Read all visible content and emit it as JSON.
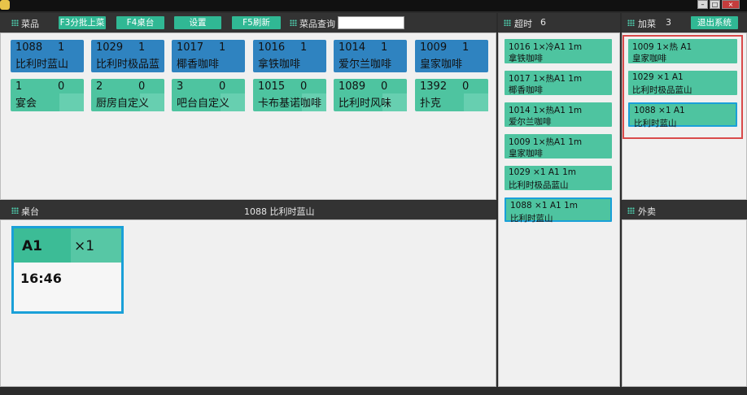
{
  "window": {
    "controls": [
      "–",
      "□",
      "×"
    ]
  },
  "toolbar": {
    "dishes_label": "菜品",
    "btn_batch": "F3分批上菜",
    "btn_table": "F4桌台",
    "btn_settings": "设置",
    "btn_refresh": "F5刷新",
    "search_label": "菜品查询",
    "search_value": ""
  },
  "dishes": [
    {
      "code": "1088",
      "count": "1",
      "name": "比利时蓝山",
      "color": "blue"
    },
    {
      "code": "1029",
      "count": "1",
      "name": "比利时极品蓝",
      "color": "blue"
    },
    {
      "code": "1017",
      "count": "1",
      "name": "椰香咖啡",
      "color": "blue"
    },
    {
      "code": "1016",
      "count": "1",
      "name": "拿铁咖啡",
      "color": "blue"
    },
    {
      "code": "1014",
      "count": "1",
      "name": "爱尔兰咖啡",
      "color": "blue"
    },
    {
      "code": "1009",
      "count": "1",
      "name": "皇家咖啡",
      "color": "blue"
    },
    {
      "code": "1",
      "count": "0",
      "name": "宴会",
      "color": "green"
    },
    {
      "code": "2",
      "count": "0",
      "name": "厨房自定义",
      "color": "green"
    },
    {
      "code": "3",
      "count": "0",
      "name": "吧台自定义",
      "color": "green"
    },
    {
      "code": "1015",
      "count": "0",
      "name": "卡布基诺咖啡",
      "color": "green"
    },
    {
      "code": "1089",
      "count": "0",
      "name": "比利时风味",
      "color": "green"
    },
    {
      "code": "1392",
      "count": "0",
      "name": "扑克",
      "color": "green"
    }
  ],
  "table_bar": {
    "label": "桌台",
    "selected_dish": "1088  比利时蓝山"
  },
  "table_card": {
    "name": "A1",
    "qty": "×1",
    "time": "16:46"
  },
  "overtime": {
    "label": "超时",
    "count": "6",
    "orders": [
      {
        "line1": "1016 1×冷A1      1m",
        "line2": "拿铁咖啡"
      },
      {
        "line1": "1017 1×热A1      1m",
        "line2": "椰香咖啡"
      },
      {
        "line1": "1014 1×热A1      1m",
        "line2": "爱尔兰咖啡"
      },
      {
        "line1": "1009 1×热A1      1m",
        "line2": "皇家咖啡"
      },
      {
        "line1": "1029 ×1   A1      1m",
        "line2": "比利时极品蓝山"
      },
      {
        "line1": "1088 ×1   A1      1m",
        "line2": "比利时蓝山"
      }
    ]
  },
  "addon": {
    "label": "加菜",
    "count": "3",
    "exit_label": "退出系统",
    "orders": [
      {
        "line1": "1009   1×热       A1",
        "line2": "皇家咖啡"
      },
      {
        "line1": "1029    ×1          A1",
        "line2": "比利时极品蓝山"
      },
      {
        "line1": "1088    ×1          A1",
        "line2": "比利时蓝山"
      }
    ]
  },
  "takeout": {
    "label": "外卖"
  },
  "colors": {
    "accent": "#30b894",
    "tile_blue": "#2f83c0",
    "tile_green": "#4ec4a0",
    "selection": "#1aa0d8",
    "highlight_box": "#d94a4a"
  }
}
